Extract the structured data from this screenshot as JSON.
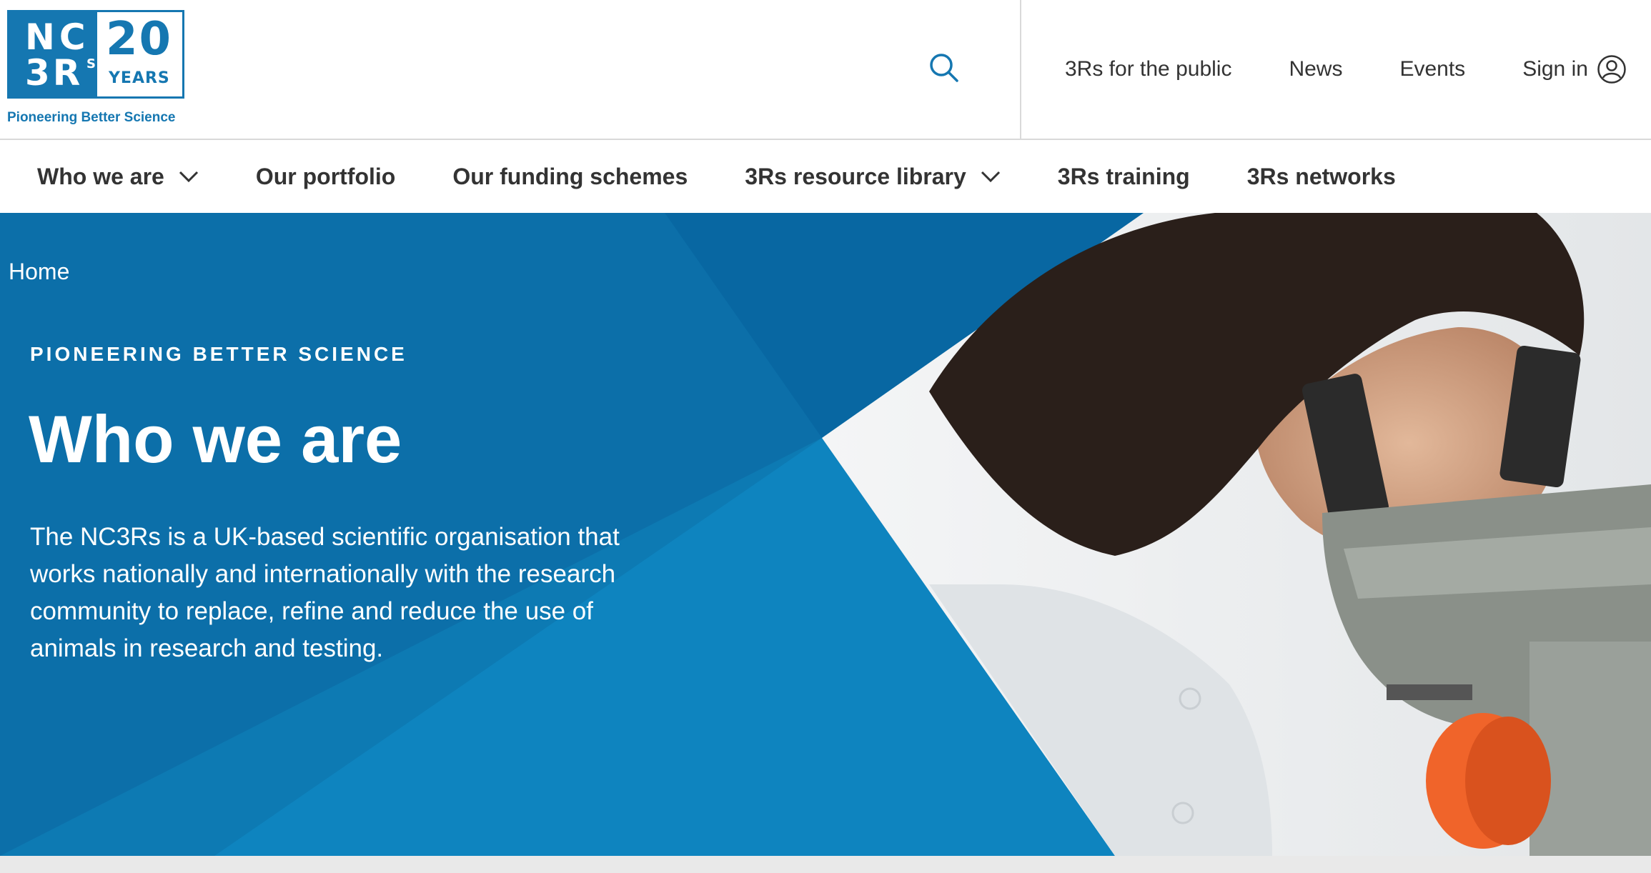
{
  "logo": {
    "nc": "NC",
    "three_r": "3R",
    "s": "S",
    "twenty": "20",
    "years": "YEARS",
    "tagline": "Pioneering Better Science"
  },
  "header": {
    "search_icon": "search-icon",
    "utility_links": [
      {
        "label": "3Rs for the public"
      },
      {
        "label": "News"
      },
      {
        "label": "Events"
      }
    ],
    "sign_in": {
      "label": "Sign in",
      "icon": "user-circle-icon"
    }
  },
  "main_nav": {
    "items": [
      {
        "label": "Who we are",
        "has_dropdown": true
      },
      {
        "label": "Our portfolio",
        "has_dropdown": false
      },
      {
        "label": "Our funding schemes",
        "has_dropdown": false
      },
      {
        "label": "3Rs resource library",
        "has_dropdown": true
      },
      {
        "label": "3Rs training",
        "has_dropdown": false
      },
      {
        "label": "3Rs networks",
        "has_dropdown": false
      }
    ]
  },
  "hero": {
    "breadcrumb": "Home",
    "eyebrow": "PIONEERING BETTER SCIENCE",
    "title": "Who we are",
    "description": "The NC3Rs is a UK-based scientific organisation that works nationally and internationally with the research community to replace, refine and reduce the use of animals in research and testing.",
    "image": "scientist-looking-through-microscope"
  },
  "colors": {
    "brand_blue": "#1577b1",
    "hero_blue": "#0d7ab3",
    "hero_dark_blue": "#0a67a3",
    "text_dark": "#333333"
  }
}
